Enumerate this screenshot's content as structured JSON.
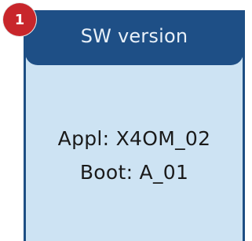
{
  "badge": {
    "number": "1"
  },
  "panel": {
    "title": "SW version",
    "appl": "Appl: X4OM_02",
    "boot": "Boot: A_01"
  },
  "colors": {
    "header": "#1e4f86",
    "panel_background": "#cde3f3",
    "badge": "#c8262b"
  }
}
